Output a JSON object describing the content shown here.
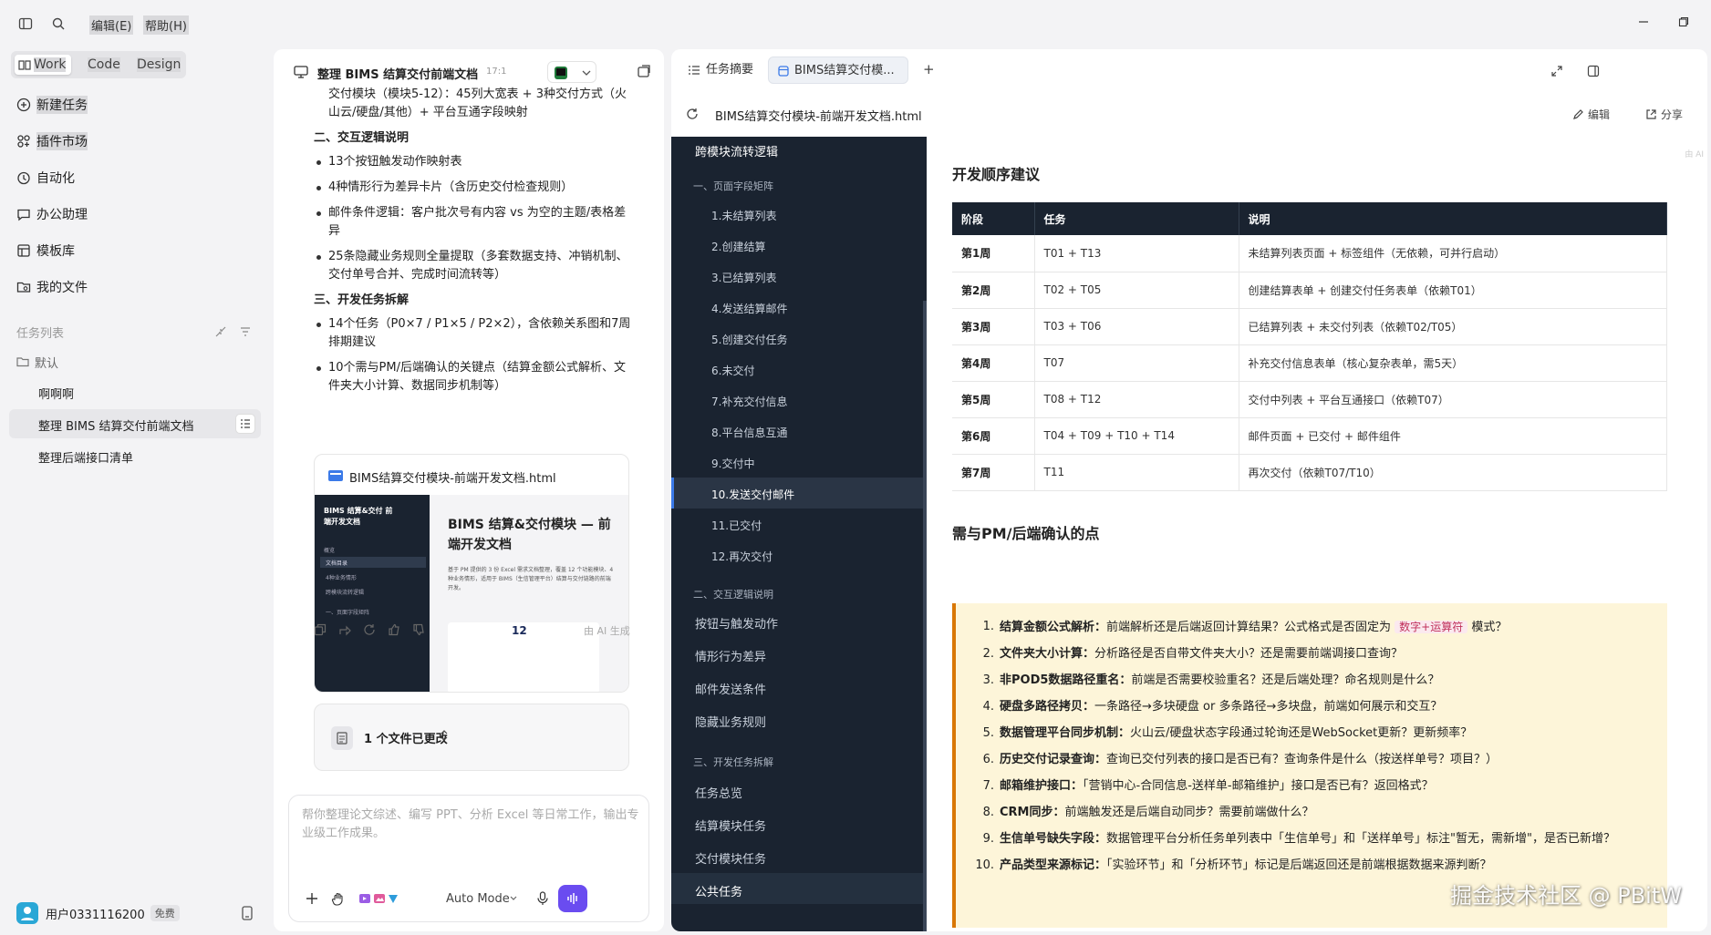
{
  "menu": {
    "edit": "编辑(E)",
    "help": "帮助(H)"
  },
  "modes": [
    "Work",
    "Code",
    "Design"
  ],
  "nav": [
    "新建任务",
    "插件市场",
    "自动化",
    "办公助理",
    "模板库",
    "我的文件"
  ],
  "tasks": {
    "section_label": "任务列表",
    "folder": "默认",
    "items": [
      "啊啊啊",
      "整理 BIMS 结算交付前端文档",
      "整理后端接口清单"
    ]
  },
  "user": {
    "name": "用户0331116200",
    "plan": "免费"
  },
  "chat": {
    "title": "整理 BIMS 结算交付前端文档",
    "time": "17:1",
    "top_line": "交付模块（模块5-12）：45列大宽表 + 3种交付方式（火山云/硬盘/其他）+ 平台互通字段映射",
    "section2": "二、交互逻辑说明",
    "section2_items": [
      "13个按钮触发动作映射表",
      "4种情形行为差异卡片（含历史交付检查规则）",
      "邮件条件逻辑：客户批次号有内容 vs 为空的主题/表格差异",
      "25条隐藏业务规则全量提取（多套数据支持、冲销机制、交付单号合并、完成时间流转等）"
    ],
    "section3": "三、开发任务拆解",
    "section3_items": [
      "14个任务（P0×7 / P1×5 / P2×2），含依赖关系图和7周排期建议",
      "10个需与PM/后端确认的关键点（结算金额公式解析、文件夹大小计算、数据同步机制等）"
    ],
    "file_card": {
      "filename": "BIMS结算交付模块-前端开发文档.html",
      "preview_side_title": "BIMS 结算&交付 前端开发文档",
      "preview_side_items": [
        "概览",
        "文档目录",
        "4种业务情形",
        "跨模块流转逻辑",
        "一、页面字段矩阵"
      ],
      "preview_heading": "BIMS 结算&交付模块 — 前端开发文档",
      "preview_desc": "基于 PM 提供的 3 份 Excel 需求文档整理，覆盖 12 个功能模块、4 种业务情形，适用于 BIMS（生信管理平台）结算与交付链路的前端开发。",
      "preview_num": "12"
    },
    "changed": "1 个文件已更改",
    "ai_note": "由 AI 生成",
    "input_placeholder": "帮你整理论文综述、编写 PPT、分析 Excel 等日常工作，输出专业级工作成果。",
    "auto_mode": "Auto Mode"
  },
  "right": {
    "tabs": [
      "任务摘要",
      "BIMS结算交付模..."
    ],
    "add_tab": "+",
    "doc_title": "BIMS结算交付模块-前端开发文档.html",
    "edit": "编辑",
    "share": "分享",
    "toc": {
      "top": "跨模块流转逻辑",
      "sec1": "一、页面字段矩阵",
      "sec1_items": [
        "1.未结算列表",
        "2.创建结算",
        "3.已结算列表",
        "4.发送结算邮件",
        "5.创建交付任务",
        "6.未交付",
        "7.补充交付信息",
        "8.平台信息互通",
        "9.交付中",
        "10.发送交付邮件",
        "11.已交付",
        "12.再次交付"
      ],
      "sec2": "二、交互逻辑说明",
      "sec2_items": [
        "按钮与触发动作",
        "情形行为差异",
        "邮件发送条件",
        "隐藏业务规则"
      ],
      "sec3": "三、开发任务拆解",
      "sec3_items": [
        "任务总览",
        "结算模块任务",
        "交付模块任务",
        "公共任务"
      ]
    },
    "corner_note": "由 AI",
    "dev_title": "开发顺序建议",
    "table_headers": [
      "阶段",
      "任务",
      "说明"
    ],
    "table_rows": [
      [
        "第1周",
        "T01 + T13",
        "未结算列表页面 + 标签组件（无依赖，可并行启动）"
      ],
      [
        "第2周",
        "T02 + T05",
        "创建结算表单 + 创建交付任务表单（依赖T01）"
      ],
      [
        "第3周",
        "T03 + T06",
        "已结算列表 + 未交付列表（依赖T02/T05）"
      ],
      [
        "第4周",
        "T07",
        "补充交付信息表单（核心复杂表单，需5天）"
      ],
      [
        "第5周",
        "T08 + T12",
        "交付中列表 + 平台互通接口（依赖T07）"
      ],
      [
        "第6周",
        "T04 + T09 + T10 + T14",
        "邮件页面 + 已交付 + 邮件组件"
      ],
      [
        "第7周",
        "T11",
        "再次交付（依赖T07/T10）"
      ]
    ],
    "confirm_title": "需与PM/后端确认的点",
    "confirm_items": [
      {
        "n": "1.",
        "b": "结算金额公式解析：",
        "pre": "前端解析还是后端返回计算结果？公式格式是否固定为",
        "code": "数字+运算符",
        "post": "模式？"
      },
      {
        "n": "2.",
        "b": "文件夹大小计算：",
        "pre": "分析路径是否自带文件夹大小？还是需要前端调接口查询？",
        "code": "",
        "post": ""
      },
      {
        "n": "3.",
        "b": "非POD5数据路径重名：",
        "pre": "前端是否需要校验重名？还是后端处理？命名规则是什么？",
        "code": "",
        "post": ""
      },
      {
        "n": "4.",
        "b": "硬盘多路径拷贝：",
        "pre": "一条路径→多块硬盘 or 多条路径→多块盘，前端如何展示和交互？",
        "code": "",
        "post": ""
      },
      {
        "n": "5.",
        "b": "数据管理平台同步机制：",
        "pre": "火山云/硬盘状态字段通过轮询还是WebSocket更新？更新频率？",
        "code": "",
        "post": ""
      },
      {
        "n": "6.",
        "b": "历史交付记录查询：",
        "pre": "查询已交付列表的接口是否已有？查询条件是什么（按送样单号？项目？）",
        "code": "",
        "post": ""
      },
      {
        "n": "7.",
        "b": "邮箱维护接口：",
        "pre": "「营销中心-合同信息-送样单-邮箱维护」接口是否已有？返回格式？",
        "code": "",
        "post": ""
      },
      {
        "n": "8.",
        "b": "CRM同步：",
        "pre": "前端触发还是后端自动同步？需要前端做什么？",
        "code": "",
        "post": ""
      },
      {
        "n": "9.",
        "b": "生信单号缺失字段：",
        "pre": "数据管理平台分析任务单列表中「生信单号」和「送样单号」标注\"暂无，需新增\"，是否已新增？",
        "code": "",
        "post": ""
      },
      {
        "n": "10.",
        "b": "产品类型来源标记：",
        "pre": "「实验环节」和「分析环节」标记是后端返回还是前端根据数据来源判断？",
        "code": "",
        "post": ""
      }
    ]
  },
  "watermark": "掘金技术社区 @ PBitW"
}
